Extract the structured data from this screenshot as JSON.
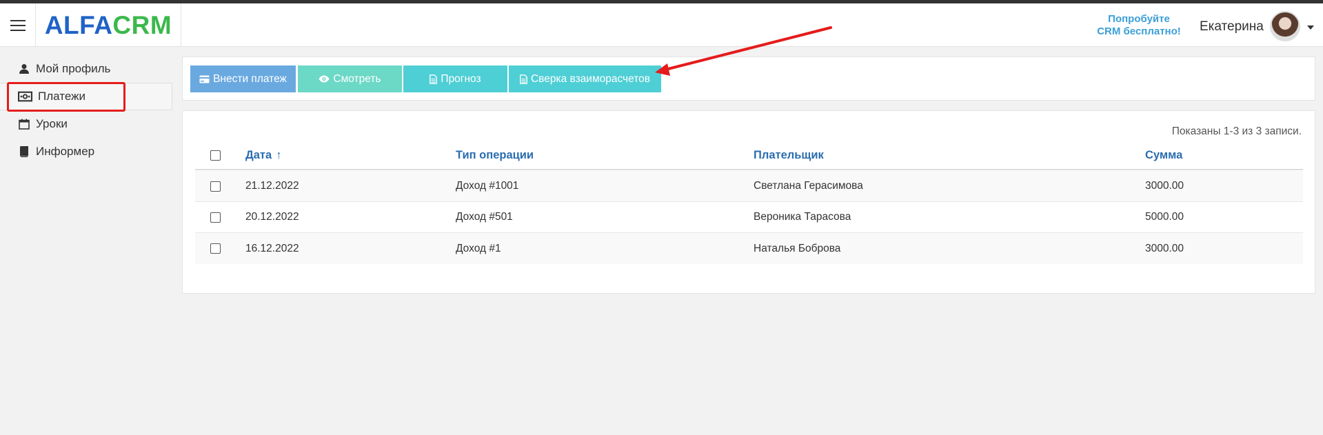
{
  "header": {
    "logo_part1": "ALFA",
    "logo_part2": "CRM",
    "try_free_line1": "Попробуйте",
    "try_free_line2": "CRM бесплатно!",
    "user_name": "Екатерина"
  },
  "sidebar": {
    "items": [
      {
        "label": "Мой профиль",
        "icon": "user-icon"
      },
      {
        "label": "Платежи",
        "icon": "money-icon"
      },
      {
        "label": "Уроки",
        "icon": "calendar-icon"
      },
      {
        "label": "Информер",
        "icon": "book-icon"
      }
    ],
    "active_index": 1
  },
  "toolbar": {
    "buttons": [
      {
        "label": "Внести платеж",
        "icon": "credit-card-icon",
        "color": "#6aa9e0"
      },
      {
        "label": "Смотреть",
        "icon": "eye-icon",
        "color": "#6cd8c6"
      },
      {
        "label": "Прогноз",
        "icon": "document-icon",
        "color": "#4ecfd5"
      },
      {
        "label": "Сверка взаиморасчетов",
        "icon": "document-icon",
        "color": "#4ecfd5"
      }
    ]
  },
  "table": {
    "summary": "Показаны 1-3 из 3 записи.",
    "columns": {
      "date": "Дата",
      "sort_indicator": "↑",
      "type": "Тип операции",
      "payer": "Плательщик",
      "sum": "Сумма"
    },
    "rows": [
      {
        "date": "21.12.2022",
        "type": "Доход #1001",
        "payer": "Светлана Герасимова",
        "sum": "3000.00"
      },
      {
        "date": "20.12.2022",
        "type": "Доход #501",
        "payer": "Вероника Тарасова",
        "sum": "5000.00"
      },
      {
        "date": "16.12.2022",
        "type": "Доход #1",
        "payer": "Наталья Боброва",
        "sum": "3000.00"
      }
    ]
  },
  "colors": {
    "accent_red": "#e41c1c",
    "link_blue": "#2a6db0",
    "logo_blue": "#1f63c6",
    "logo_green": "#3cb84c"
  }
}
